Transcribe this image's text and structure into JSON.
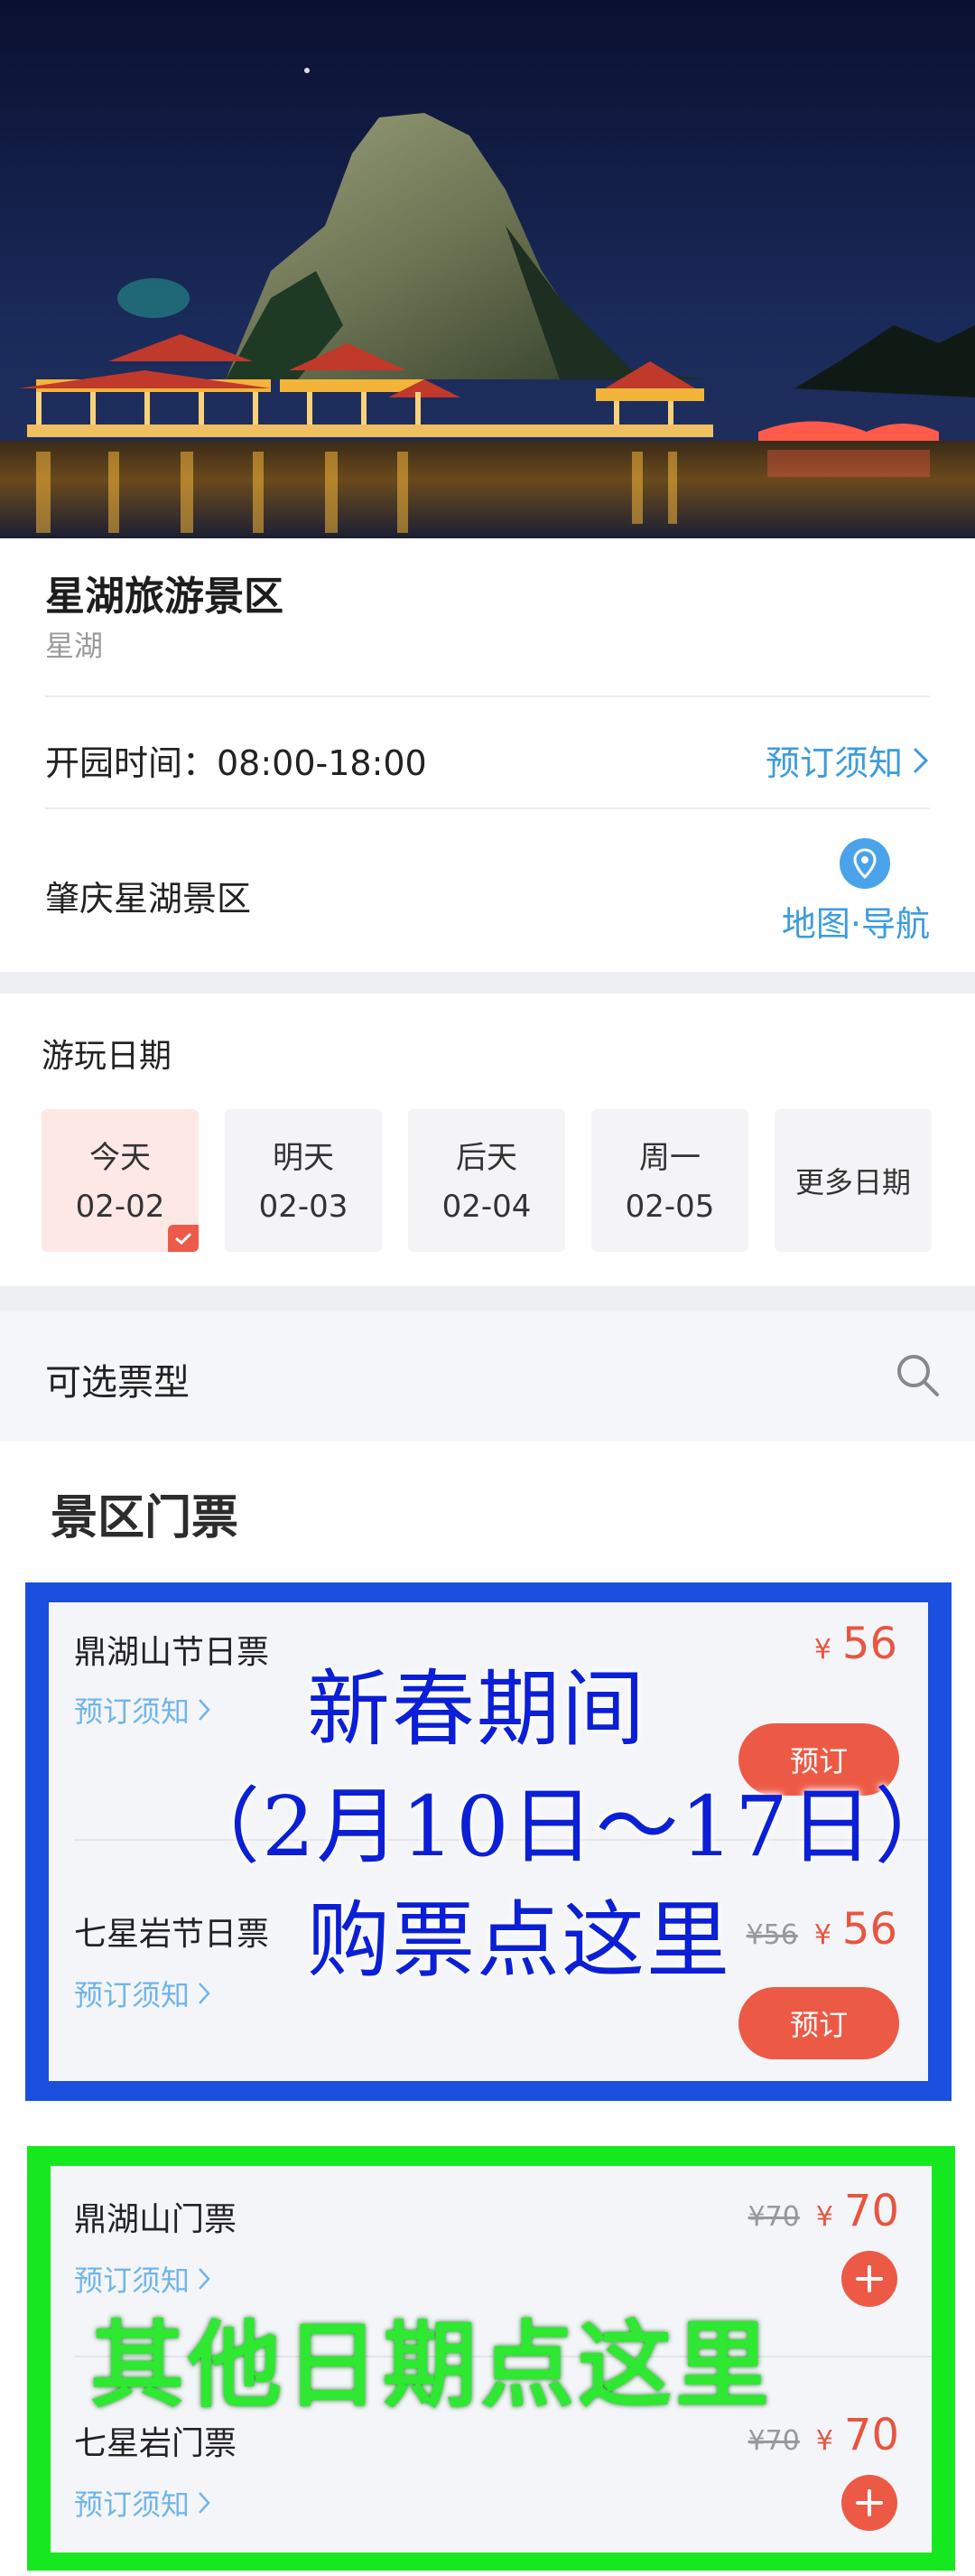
{
  "hero": {
    "alt_icon": "scenic-photo"
  },
  "info": {
    "title": "星湖旅游景区",
    "subtitle": "星湖",
    "hours": "开园时间：08:00-18:00",
    "notice_link": "预订须知",
    "address": "肇庆星湖景区",
    "map_link": "地图·导航"
  },
  "dates": {
    "label": "游玩日期",
    "items": [
      {
        "day": "今天",
        "date": "02-02"
      },
      {
        "day": "明天",
        "date": "02-03"
      },
      {
        "day": "后天",
        "date": "02-04"
      },
      {
        "day": "周一",
        "date": "02-05"
      }
    ],
    "more": "更多日期"
  },
  "ticket_bar": {
    "label": "可选票型"
  },
  "tickets": {
    "section_title": "景区门票",
    "holiday": [
      {
        "name": "鼎湖山节日票",
        "notice": "预订须知",
        "yen": "¥",
        "price": "56",
        "button": "预订"
      },
      {
        "name": "七星岩节日票",
        "notice": "预订须知",
        "old_price": "¥56",
        "yen": "¥",
        "price": "56",
        "button": "预订"
      }
    ],
    "regular": [
      {
        "name": "鼎湖山门票",
        "notice": "预订须知",
        "old_price": "¥70",
        "yen": "¥",
        "price": "70"
      },
      {
        "name": "七星岩门票",
        "notice": "预订须知",
        "old_price": "¥70",
        "yen": "¥",
        "price": "70"
      }
    ]
  },
  "overlays": {
    "blue_line1": "新春期间",
    "blue_line2": "（2月10日～17日）",
    "blue_line3": "购票点这里",
    "green": "其他日期点这里"
  },
  "colors": {
    "accent_red": "#ec5a45",
    "link_blue": "#3d9be0",
    "frame_blue": "#1a4fe0",
    "frame_green": "#16e81f"
  }
}
